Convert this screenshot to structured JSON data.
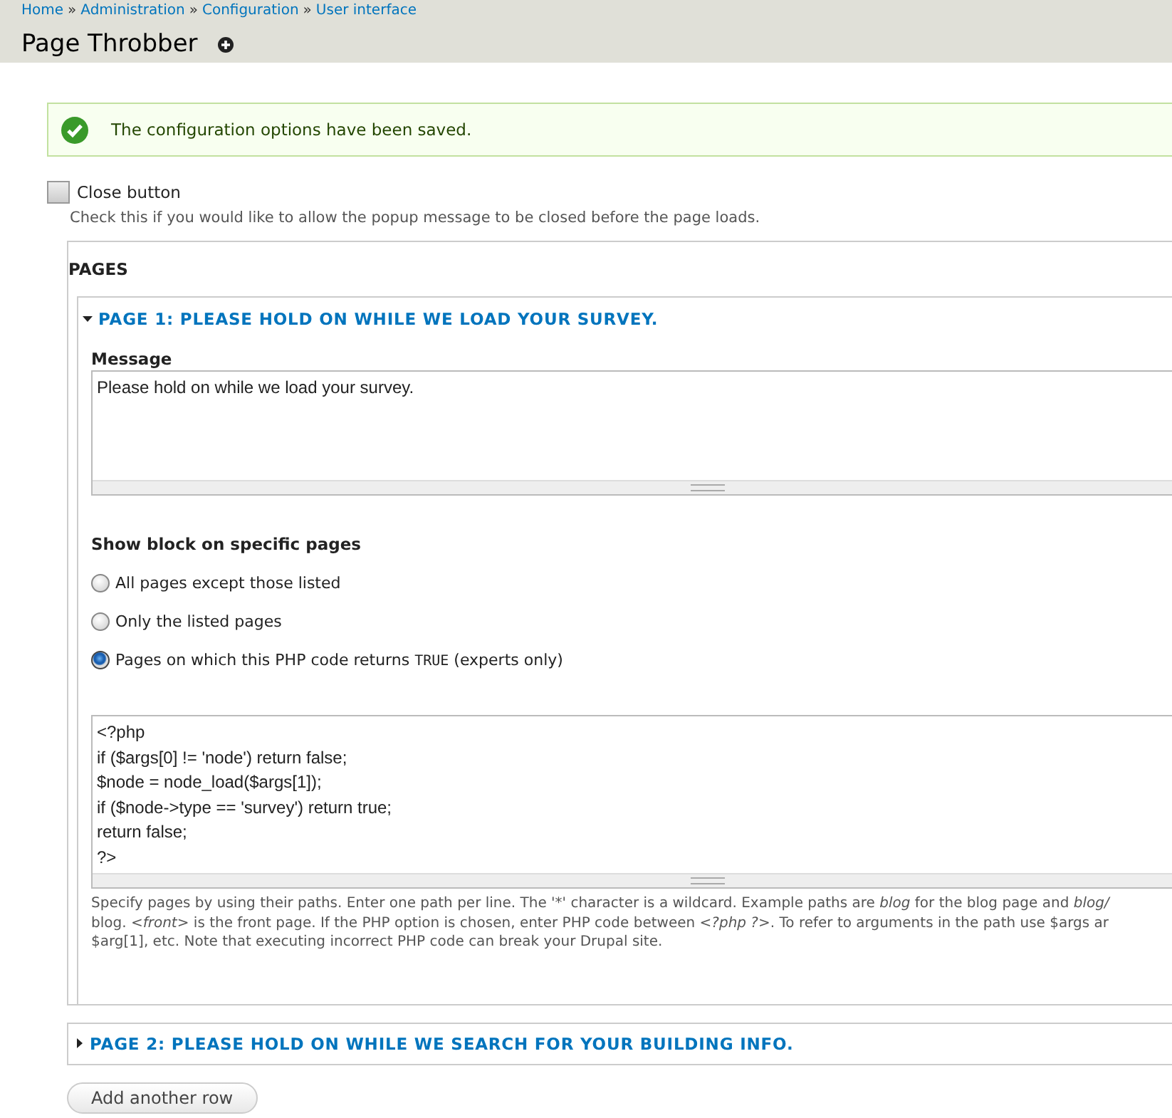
{
  "breadcrumb": [
    "Home",
    "Administration",
    "Configuration",
    "User interface"
  ],
  "breadcrumb_separator": "»",
  "page_title": "Page Throbber",
  "status_message": {
    "text": "The configuration options have been saved."
  },
  "close_button": {
    "label": "Close button",
    "checked": false,
    "description": "Check this if you would like to allow the popup message to be closed before the page loads."
  },
  "pages": {
    "legend": "PAGES",
    "items": [
      {
        "title": "PAGE 1: PLEASE HOLD ON WHILE WE LOAD YOUR SURVEY.",
        "expanded": true,
        "message_label": "Message",
        "message": "Please hold on while we load your survey.",
        "visibility_label": "Show block on specific pages",
        "options": [
          {
            "parts": [
              {
                "text": "All pages except those listed",
                "code": false
              }
            ],
            "selected": false
          },
          {
            "parts": [
              {
                "text": "Only the listed pages",
                "code": false
              }
            ],
            "selected": false
          },
          {
            "parts": [
              {
                "text": "Pages on which this PHP code returns ",
                "code": false
              },
              {
                "text": "TRUE",
                "code": true
              },
              {
                "text": " (experts only)",
                "code": false
              }
            ],
            "selected": true
          }
        ],
        "code_lines": [
          "<?php",
          "if ($args[0] != 'node') return false;",
          "$node = node_load($args[1]);",
          "if ($node->type == 'survey') return true;",
          "return false;",
          "?>"
        ],
        "help_lines": [
          [
            {
              "text": "Specify pages by using their paths. Enter one path per line. The '*' character is a wildcard. Example paths are ",
              "italic": false
            },
            {
              "text": "blog",
              "italic": true
            },
            {
              "text": " for the blog page and ",
              "italic": false
            },
            {
              "text": "blog/",
              "italic": true
            }
          ],
          [
            {
              "text": "blog. ",
              "italic": false
            },
            {
              "text": "<front>",
              "italic": true
            },
            {
              "text": " is the front page. If the PHP option is chosen, enter PHP code between ",
              "italic": false
            },
            {
              "text": "<?php ?>",
              "italic": true
            },
            {
              "text": ". To refer to arguments in the path use $args ar",
              "italic": false
            }
          ],
          [
            {
              "text": "$arg[1], etc. Note that executing incorrect PHP code can break your Drupal site.",
              "italic": false
            }
          ]
        ]
      },
      {
        "title": "PAGE 2: PLEASE HOLD ON WHILE WE SEARCH FOR YOUR BUILDING INFO.",
        "expanded": false
      }
    ]
  },
  "add_button": "Add another row"
}
